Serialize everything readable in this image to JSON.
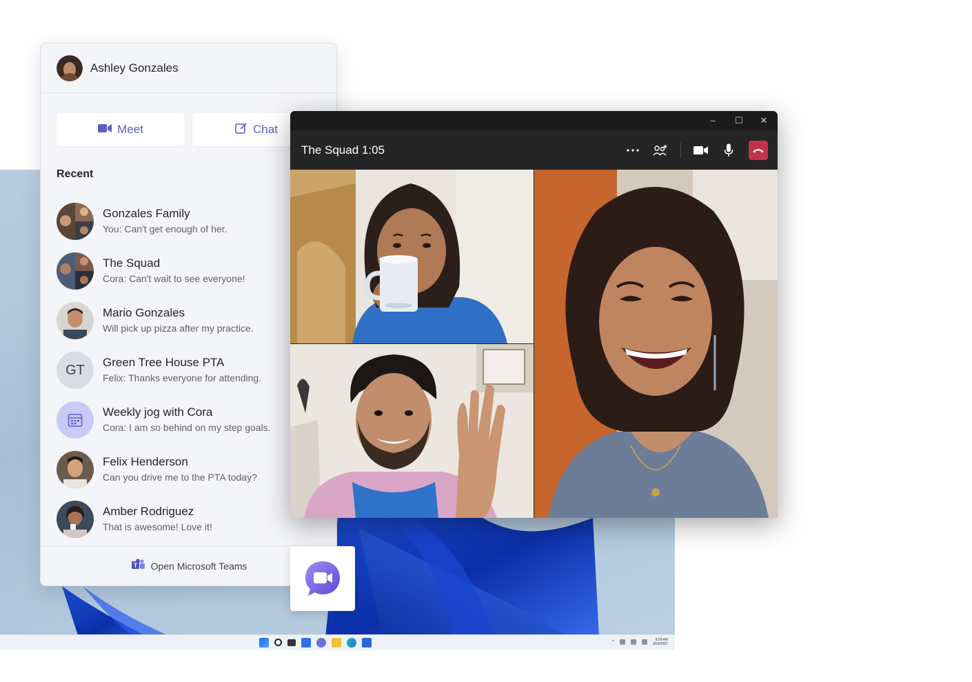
{
  "flyout": {
    "user_name": "Ashley Gonzales",
    "meet_label": "Meet",
    "chat_label": "Chat",
    "recent_title": "Recent",
    "chats": [
      {
        "name": "Gonzales Family",
        "preview": "You: Can't get enough of her."
      },
      {
        "name": "The Squad",
        "preview": "Cora: Can't wait to see everyone!"
      },
      {
        "name": "Mario Gonzales",
        "preview": "Will pick up pizza after my practice."
      },
      {
        "name": "Green Tree House PTA",
        "preview": "Felix: Thanks everyone for attending.",
        "initials": "GT"
      },
      {
        "name": "Weekly jog with Cora",
        "preview": "Cora: I am so behind on my step goals."
      },
      {
        "name": "Felix Henderson",
        "preview": "Can you drive me to the PTA today?"
      },
      {
        "name": "Amber Rodriguez",
        "preview": "That is awesome! Love it!"
      }
    ],
    "footer_label": "Open Microsoft Teams"
  },
  "call": {
    "title": "The Squad 1:05",
    "window_controls": {
      "minimize": "–",
      "maximize": "☐",
      "close": "✕"
    },
    "icons": [
      "more-icon",
      "participants-icon",
      "camera-icon",
      "mic-icon",
      "hangup-icon"
    ],
    "colors": {
      "hangup": "#c4314b",
      "accent": "#5b5fc7"
    }
  },
  "taskbar": {
    "clock_time": "9:26 AM",
    "clock_date": "10/6/2021"
  }
}
